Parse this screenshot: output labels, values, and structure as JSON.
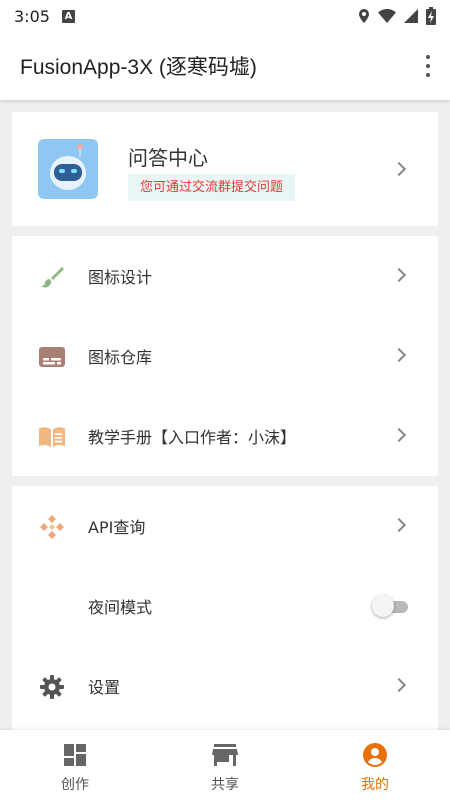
{
  "status_bar": {
    "time": "3:05",
    "notification_letter": "A"
  },
  "app_bar": {
    "title": "FusionApp-3X (逐寒码墟)"
  },
  "qa_card": {
    "title": "问答中心",
    "subtitle": "您可通过交流群提交问题"
  },
  "menu_group_1": [
    {
      "label": "图标设计",
      "icon": "paintbrush-icon"
    },
    {
      "label": "图标仓库",
      "icon": "subtitles-icon"
    },
    {
      "label": "教学手册【入口作者：小沫】",
      "icon": "open-book-icon"
    }
  ],
  "menu_group_2": [
    {
      "label": "API查询",
      "icon": "api-diamond-icon"
    },
    {
      "label": "夜间模式",
      "icon": "moon-icon",
      "toggle": false
    },
    {
      "label": "设置",
      "icon": "gear-icon"
    }
  ],
  "bottom_nav": [
    {
      "label": "创作",
      "icon": "dashboard-icon",
      "active": false
    },
    {
      "label": "共享",
      "icon": "store-icon",
      "active": false
    },
    {
      "label": "我的",
      "icon": "account-circle-icon",
      "active": true
    }
  ],
  "colors": {
    "accent": "#e8710a",
    "badge_text": "#e53935",
    "badge_bg": "#e8f7f5",
    "background": "#efefef"
  }
}
